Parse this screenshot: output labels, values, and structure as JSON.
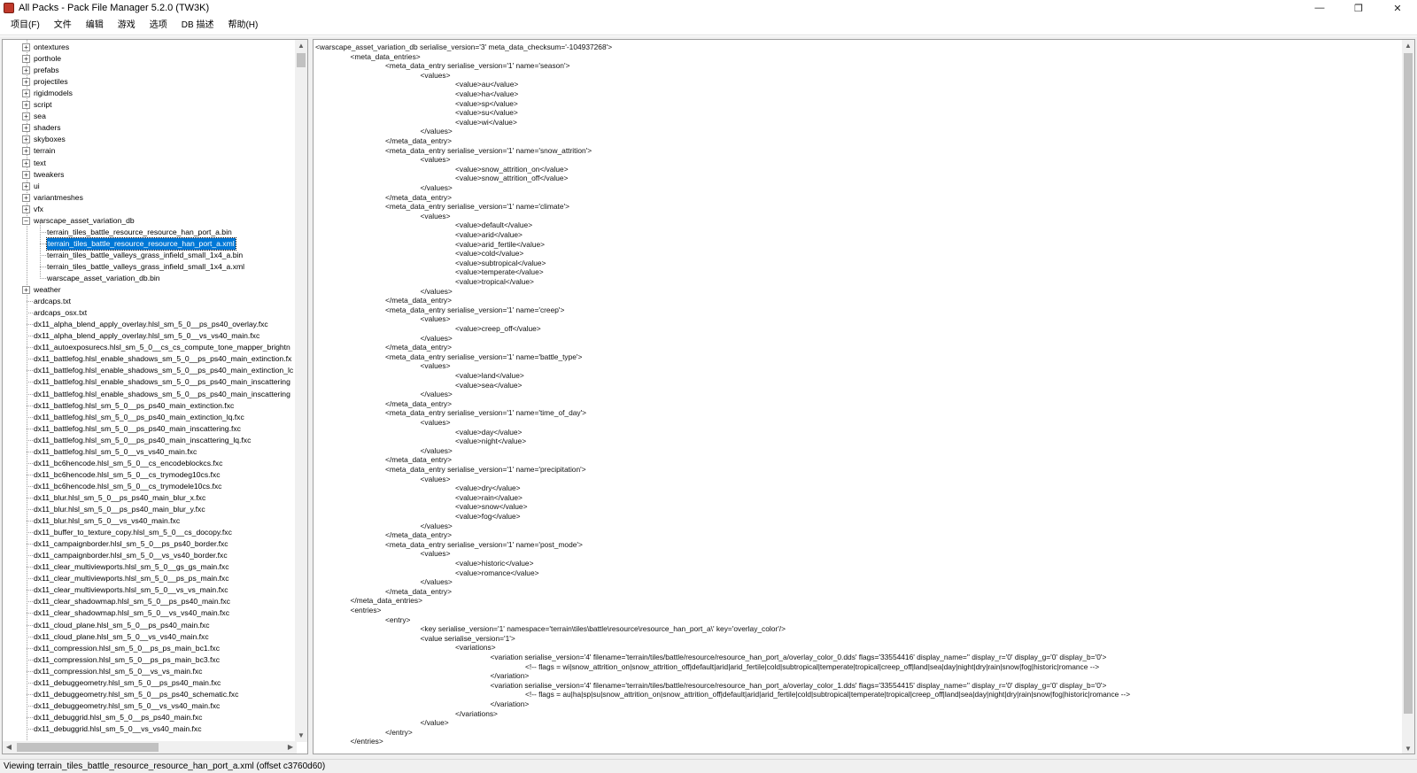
{
  "window": {
    "title": "All Packs - Pack File Manager 5.2.0 (TW3K)",
    "min_glyph": "—",
    "max_glyph": "❐",
    "close_glyph": "✕"
  },
  "menu": [
    "项目(F)",
    "文件",
    "编辑",
    "游戏",
    "选项",
    "DB 描述",
    "帮助(H)"
  ],
  "tree": {
    "folders": [
      "ontextures",
      "porthole",
      "prefabs",
      "projectiles",
      "rigidmodels",
      "script",
      "sea",
      "shaders",
      "skyboxes",
      "terrain",
      "text",
      "tweakers",
      "ui",
      "variantmeshes",
      "vfx"
    ],
    "expanded_folder": "warscape_asset_variation_db",
    "expanded_children": [
      "terrain_tiles_battle_resource_resource_han_port_a.bin",
      "terrain_tiles_battle_resource_resource_han_port_a.xml",
      "terrain_tiles_battle_valleys_grass_infield_small_1x4_a.bin",
      "terrain_tiles_battle_valleys_grass_infield_small_1x4_a.xml",
      "warscape_asset_variation_db.bin"
    ],
    "selected_child_index": 1,
    "folders_after": [
      "weather"
    ],
    "files": [
      "ardcaps.txt",
      "ardcaps_osx.txt",
      "dx11_alpha_blend_apply_overlay.hlsl_sm_5_0__ps_ps40_overlay.fxc",
      "dx11_alpha_blend_apply_overlay.hlsl_sm_5_0__vs_vs40_main.fxc",
      "dx11_autoexposurecs.hlsl_sm_5_0__cs_cs_compute_tone_mapper_brightn",
      "dx11_battlefog.hlsl_enable_shadows_sm_5_0__ps_ps40_main_extinction.fx",
      "dx11_battlefog.hlsl_enable_shadows_sm_5_0__ps_ps40_main_extinction_lc",
      "dx11_battlefog.hlsl_enable_shadows_sm_5_0__ps_ps40_main_inscattering",
      "dx11_battlefog.hlsl_enable_shadows_sm_5_0__ps_ps40_main_inscattering",
      "dx11_battlefog.hlsl_sm_5_0__ps_ps40_main_extinction.fxc",
      "dx11_battlefog.hlsl_sm_5_0__ps_ps40_main_extinction_lq.fxc",
      "dx11_battlefog.hlsl_sm_5_0__ps_ps40_main_inscattering.fxc",
      "dx11_battlefog.hlsl_sm_5_0__ps_ps40_main_inscattering_lq.fxc",
      "dx11_battlefog.hlsl_sm_5_0__vs_vs40_main.fxc",
      "dx11_bc6hencode.hlsl_sm_5_0__cs_encodeblockcs.fxc",
      "dx11_bc6hencode.hlsl_sm_5_0__cs_trymodeg10cs.fxc",
      "dx11_bc6hencode.hlsl_sm_5_0__cs_trymodele10cs.fxc",
      "dx11_blur.hlsl_sm_5_0__ps_ps40_main_blur_x.fxc",
      "dx11_blur.hlsl_sm_5_0__ps_ps40_main_blur_y.fxc",
      "dx11_blur.hlsl_sm_5_0__vs_vs40_main.fxc",
      "dx11_buffer_to_texture_copy.hlsl_sm_5_0__cs_docopy.fxc",
      "dx11_campaignborder.hlsl_sm_5_0__ps_ps40_border.fxc",
      "dx11_campaignborder.hlsl_sm_5_0__vs_vs40_border.fxc",
      "dx11_clear_multiviewports.hlsl_sm_5_0__gs_gs_main.fxc",
      "dx11_clear_multiviewports.hlsl_sm_5_0__ps_ps_main.fxc",
      "dx11_clear_multiviewports.hlsl_sm_5_0__vs_vs_main.fxc",
      "dx11_clear_shadowmap.hlsl_sm_5_0__ps_ps40_main.fxc",
      "dx11_clear_shadowmap.hlsl_sm_5_0__vs_vs40_main.fxc",
      "dx11_cloud_plane.hlsl_sm_5_0__ps_ps40_main.fxc",
      "dx11_cloud_plane.hlsl_sm_5_0__vs_vs40_main.fxc",
      "dx11_compression.hlsl_sm_5_0__ps_ps_main_bc1.fxc",
      "dx11_compression.hlsl_sm_5_0__ps_ps_main_bc3.fxc",
      "dx11_compression.hlsl_sm_5_0__vs_vs_main.fxc",
      "dx11_debuggeometry.hlsl_sm_5_0__ps_ps40_main.fxc",
      "dx11_debuggeometry.hlsl_sm_5_0__ps_ps40_schematic.fxc",
      "dx11_debuggeometry.hlsl_sm_5_0__vs_vs40_main.fxc",
      "dx11_debuggrid.hlsl_sm_5_0__ps_ps40_main.fxc",
      "dx11_debuggrid.hlsl_sm_5_0__vs_vs40_main.fxc"
    ]
  },
  "editor": {
    "lines": [
      {
        "indent": 0,
        "text": "<warscape_asset_variation_db serialise_version='3' meta_data_checksum='-104937268'>"
      },
      {
        "indent": 1,
        "text": "<meta_data_entries>"
      },
      {
        "indent": 2,
        "text": "<meta_data_entry serialise_version='1' name='season'>"
      },
      {
        "indent": 3,
        "text": "<values>"
      },
      {
        "indent": 4,
        "text": "<value>au</value>"
      },
      {
        "indent": 4,
        "text": "<value>ha</value>"
      },
      {
        "indent": 4,
        "text": "<value>sp</value>"
      },
      {
        "indent": 4,
        "text": "<value>su</value>"
      },
      {
        "indent": 4,
        "text": "<value>wi</value>"
      },
      {
        "indent": 3,
        "text": "</values>"
      },
      {
        "indent": 2,
        "text": "</meta_data_entry>"
      },
      {
        "indent": 2,
        "text": "<meta_data_entry serialise_version='1' name='snow_attrition'>"
      },
      {
        "indent": 3,
        "text": "<values>"
      },
      {
        "indent": 4,
        "text": "<value>snow_attrition_on</value>"
      },
      {
        "indent": 4,
        "text": "<value>snow_attrition_off</value>"
      },
      {
        "indent": 3,
        "text": "</values>"
      },
      {
        "indent": 2,
        "text": "</meta_data_entry>"
      },
      {
        "indent": 2,
        "text": "<meta_data_entry serialise_version='1' name='climate'>"
      },
      {
        "indent": 3,
        "text": "<values>"
      },
      {
        "indent": 4,
        "text": "<value>default</value>"
      },
      {
        "indent": 4,
        "text": "<value>arid</value>"
      },
      {
        "indent": 4,
        "text": "<value>arid_fertile</value>"
      },
      {
        "indent": 4,
        "text": "<value>cold</value>"
      },
      {
        "indent": 4,
        "text": "<value>subtropical</value>"
      },
      {
        "indent": 4,
        "text": "<value>temperate</value>"
      },
      {
        "indent": 4,
        "text": "<value>tropical</value>"
      },
      {
        "indent": 3,
        "text": "</values>"
      },
      {
        "indent": 2,
        "text": "</meta_data_entry>"
      },
      {
        "indent": 2,
        "text": "<meta_data_entry serialise_version='1' name='creep'>"
      },
      {
        "indent": 3,
        "text": "<values>"
      },
      {
        "indent": 4,
        "text": "<value>creep_off</value>"
      },
      {
        "indent": 3,
        "text": "</values>"
      },
      {
        "indent": 2,
        "text": "</meta_data_entry>"
      },
      {
        "indent": 2,
        "text": "<meta_data_entry serialise_version='1' name='battle_type'>"
      },
      {
        "indent": 3,
        "text": "<values>"
      },
      {
        "indent": 4,
        "text": "<value>land</value>"
      },
      {
        "indent": 4,
        "text": "<value>sea</value>"
      },
      {
        "indent": 3,
        "text": "</values>"
      },
      {
        "indent": 2,
        "text": "</meta_data_entry>"
      },
      {
        "indent": 2,
        "text": "<meta_data_entry serialise_version='1' name='time_of_day'>"
      },
      {
        "indent": 3,
        "text": "<values>"
      },
      {
        "indent": 4,
        "text": "<value>day</value>"
      },
      {
        "indent": 4,
        "text": "<value>night</value>"
      },
      {
        "indent": 3,
        "text": "</values>"
      },
      {
        "indent": 2,
        "text": "</meta_data_entry>"
      },
      {
        "indent": 2,
        "text": "<meta_data_entry serialise_version='1' name='precipitation'>"
      },
      {
        "indent": 3,
        "text": "<values>"
      },
      {
        "indent": 4,
        "text": "<value>dry</value>"
      },
      {
        "indent": 4,
        "text": "<value>rain</value>"
      },
      {
        "indent": 4,
        "text": "<value>snow</value>"
      },
      {
        "indent": 4,
        "text": "<value>fog</value>"
      },
      {
        "indent": 3,
        "text": "</values>"
      },
      {
        "indent": 2,
        "text": "</meta_data_entry>"
      },
      {
        "indent": 2,
        "text": "<meta_data_entry serialise_version='1' name='post_mode'>"
      },
      {
        "indent": 3,
        "text": "<values>"
      },
      {
        "indent": 4,
        "text": "<value>historic</value>"
      },
      {
        "indent": 4,
        "text": "<value>romance</value>"
      },
      {
        "indent": 3,
        "text": "</values>"
      },
      {
        "indent": 2,
        "text": "</meta_data_entry>"
      },
      {
        "indent": 1,
        "text": "</meta_data_entries>"
      },
      {
        "indent": 1,
        "text": "<entries>"
      },
      {
        "indent": 2,
        "text": "<entry>"
      },
      {
        "indent": 3,
        "text": "<key serialise_version='1' namespace='terrain\\tiles\\battle\\resource\\resource_han_port_a\\' key='overlay_color'/>"
      },
      {
        "indent": 3,
        "text": "<value serialise_version='1'>"
      },
      {
        "indent": 4,
        "text": "<variations>"
      },
      {
        "indent": 5,
        "text": "<variation serialise_version='4' filename='terrain/tiles/battle/resource/resource_han_port_a/overlay_color_0.dds' flags='33554416' display_name='' display_r='0' display_g='0' display_b='0'>"
      },
      {
        "indent": 6,
        "text": "<!-- flags = wi|snow_attrition_on|snow_attrition_off|default|arid|arid_fertile|cold|subtropical|temperate|tropical|creep_off|land|sea|day|night|dry|rain|snow|fog|historic|romance -->"
      },
      {
        "indent": 5,
        "text": "</variation>"
      },
      {
        "indent": 5,
        "text": "<variation serialise_version='4' filename='terrain/tiles/battle/resource/resource_han_port_a/overlay_color_1.dds' flags='33554415' display_name='' display_r='0' display_g='0' display_b='0'>"
      },
      {
        "indent": 6,
        "text": "<!-- flags = au|ha|sp|su|snow_attrition_on|snow_attrition_off|default|arid|arid_fertile|cold|subtropical|temperate|tropical|creep_off|land|sea|day|night|dry|rain|snow|fog|historic|romance -->"
      },
      {
        "indent": 5,
        "text": "</variation>"
      },
      {
        "indent": 4,
        "text": "</variations>"
      },
      {
        "indent": 3,
        "text": "</value>"
      },
      {
        "indent": 2,
        "text": "</entry>"
      },
      {
        "indent": 1,
        "text": "</entries>"
      }
    ]
  },
  "status": {
    "text": "Viewing terrain_tiles_battle_resource_resource_han_port_a.xml (offset c3760d60)"
  },
  "colors": {
    "selection": "#0078d7",
    "background": "#ffffff",
    "chrome": "#f0f0f0"
  }
}
